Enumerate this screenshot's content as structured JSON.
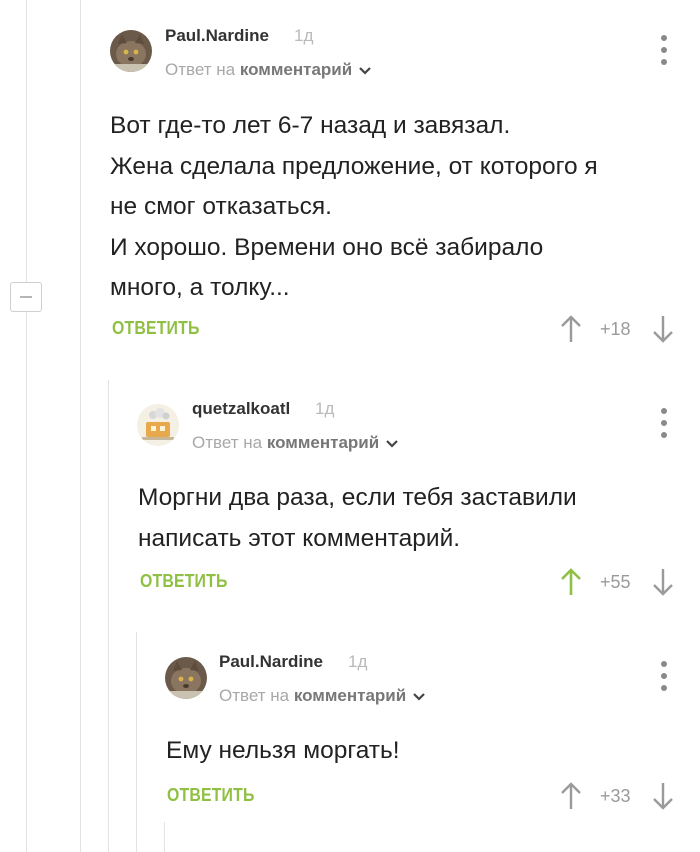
{
  "comments": [
    {
      "author": "Paul.Nardine",
      "age": "1д",
      "reply_prefix": "Ответ на",
      "reply_link": "комментарий",
      "text": "Вот где-то лет 6-7 назад и завязал.\nЖена сделала предложение, от которого я\nне смог отказаться.\nИ хорошо. Времени оно всё забирало\nмного, а толку...",
      "reply_label": "ОТВЕТИТЬ",
      "score": "+18",
      "upvoted": false
    },
    {
      "author": "quetzalkoatl",
      "age": "1д",
      "reply_prefix": "Ответ на",
      "reply_link": "комментарий",
      "text": "Моргни два раза, если тебя заставили\nнаписать этот комментарий.",
      "reply_label": "ОТВЕТИТЬ",
      "score": "+55",
      "upvoted": true
    },
    {
      "author": "Paul.Nardine",
      "age": "1д",
      "reply_prefix": "Ответ на",
      "reply_link": "комментарий",
      "text": "Ему нельзя моргать!",
      "reply_label": "ОТВЕТИТЬ",
      "score": "+33",
      "upvoted": false
    }
  ],
  "colors": {
    "accent_green": "#8fc043",
    "upvoted_arrow": "#8fc043",
    "arrow_default": "#9a9a9a"
  }
}
